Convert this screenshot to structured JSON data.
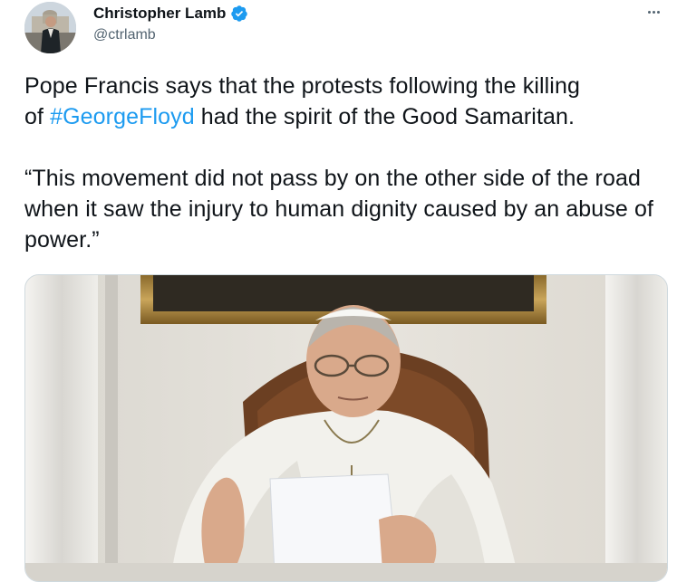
{
  "author": {
    "display_name": "Christopher Lamb",
    "handle": "@ctrlamb",
    "verified": true,
    "avatar_icon": "profile-photo"
  },
  "tweet": {
    "line1_pre": "Pope Francis says that the protests following the killing",
    "line2_pre": "of ",
    "hashtag": "#GeorgeFloyd",
    "line2_post": " had the spirit of the Good Samaritan.",
    "quote": "“This movement did not pass by on the other side of the road when it saw the injury to human dignity caused by an abuse of power.”"
  },
  "media": {
    "type": "video-frame",
    "icon": "video-still-pope"
  },
  "colors": {
    "hashtag": "#1d9bf0",
    "verified": "#1d9bf0",
    "secondary_text": "#536471",
    "primary_text": "#0f1419"
  },
  "menu": {
    "icon": "more-horizontal-icon"
  }
}
